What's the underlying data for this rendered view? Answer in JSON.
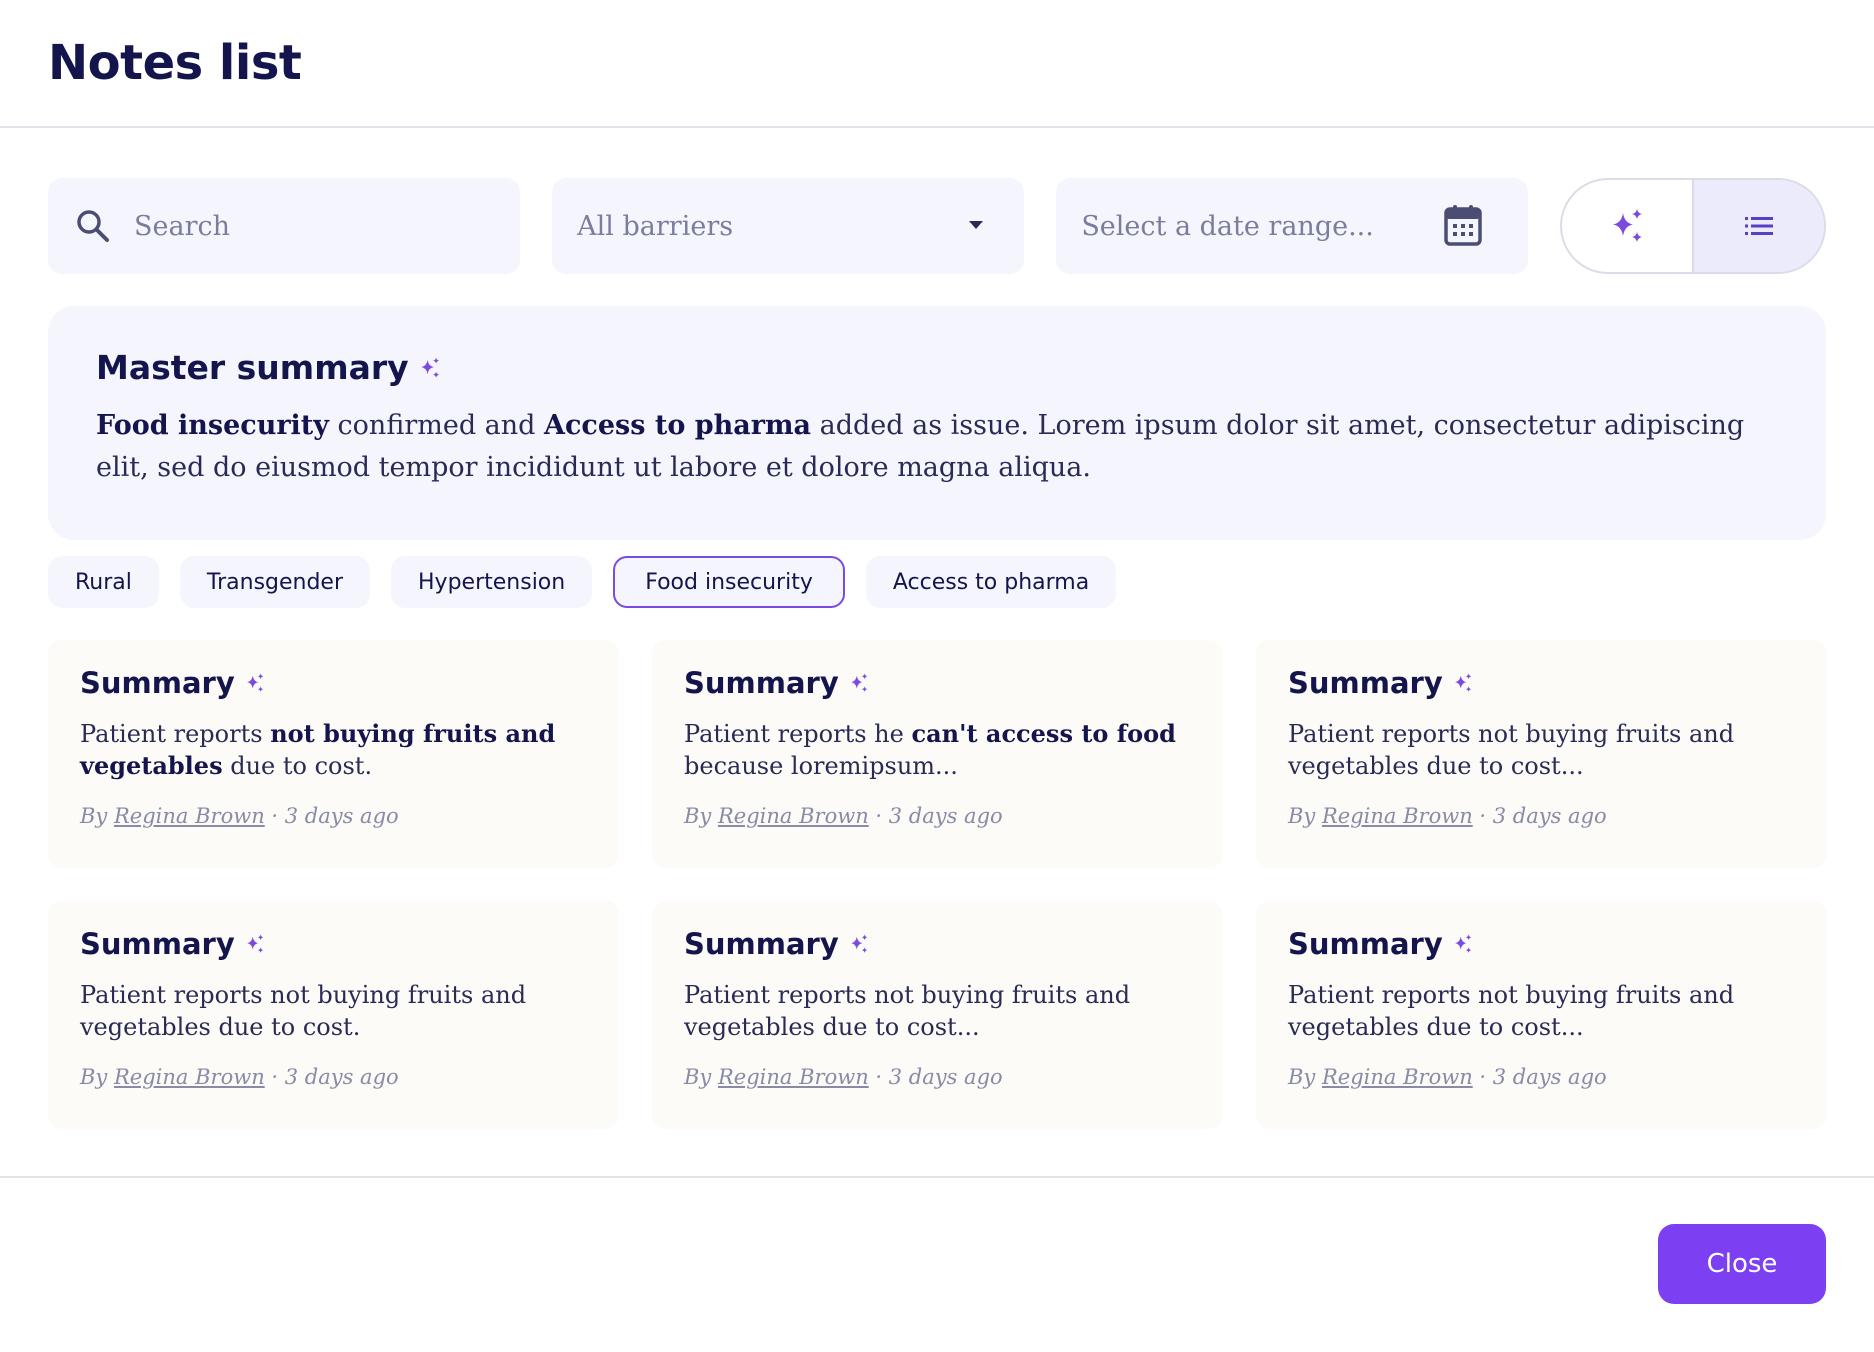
{
  "header": {
    "title": "Notes list"
  },
  "toolbar": {
    "search_placeholder": "Search",
    "barriers_value": "All barriers",
    "date_placeholder": "Select a date range..."
  },
  "master_summary": {
    "title": "Master summary",
    "bold1": "Food insecurity",
    "text1": " confirmed and ",
    "bold2": "Access to pharma",
    "text2": " added as issue. Lorem ipsum dolor sit amet, consectetur adipiscing elit, sed do eiusmod tempor incididunt ut labore et dolore magna aliqua."
  },
  "chips": [
    {
      "label": "Rural"
    },
    {
      "label": "Transgender"
    },
    {
      "label": "Hypertension"
    },
    {
      "label": "Food insecurity",
      "selected": true
    },
    {
      "label": "Access to pharma"
    }
  ],
  "cards": [
    {
      "title": "Summary",
      "pre": "Patient reports ",
      "bold": "not buying fruits and vegetables",
      "post": " due to cost.",
      "by": "By ",
      "author": "Regina Brown",
      "time": " · 3 days ago"
    },
    {
      "title": "Summary",
      "pre": "Patient reports he ",
      "bold": "can't access to food",
      "post": " because loremipsum...",
      "by": "By ",
      "author": "Regina Brown",
      "time": " · 3 days ago"
    },
    {
      "title": "Summary",
      "pre": "Patient reports not buying fruits and vegetables due to cost...",
      "bold": "",
      "post": "",
      "by": "By ",
      "author": "Regina Brown",
      "time": " · 3 days ago"
    },
    {
      "title": "Summary",
      "pre": "Patient reports not buying fruits and vegetables due to cost.",
      "bold": "",
      "post": "",
      "by": "By ",
      "author": "Regina Brown",
      "time": " · 3 days ago"
    },
    {
      "title": "Summary",
      "pre": "Patient reports not buying fruits and vegetables due to cost...",
      "bold": "",
      "post": "",
      "by": "By ",
      "author": "Regina Brown",
      "time": " · 3 days ago"
    },
    {
      "title": "Summary",
      "pre": "Patient reports not buying fruits and vegetables due to cost...",
      "bold": "",
      "post": "",
      "by": "By ",
      "author": "Regina Brown",
      "time": " · 3 days ago"
    }
  ],
  "footer": {
    "close_label": "Close"
  },
  "colors": {
    "accent": "#7c3ff2",
    "ink": "#14154d",
    "panel": "#f5f5fd",
    "card": "#fcfbf8"
  },
  "icons": [
    "search-icon",
    "caret-down-icon",
    "calendar-icon",
    "sparkle-icon",
    "list-icon"
  ]
}
